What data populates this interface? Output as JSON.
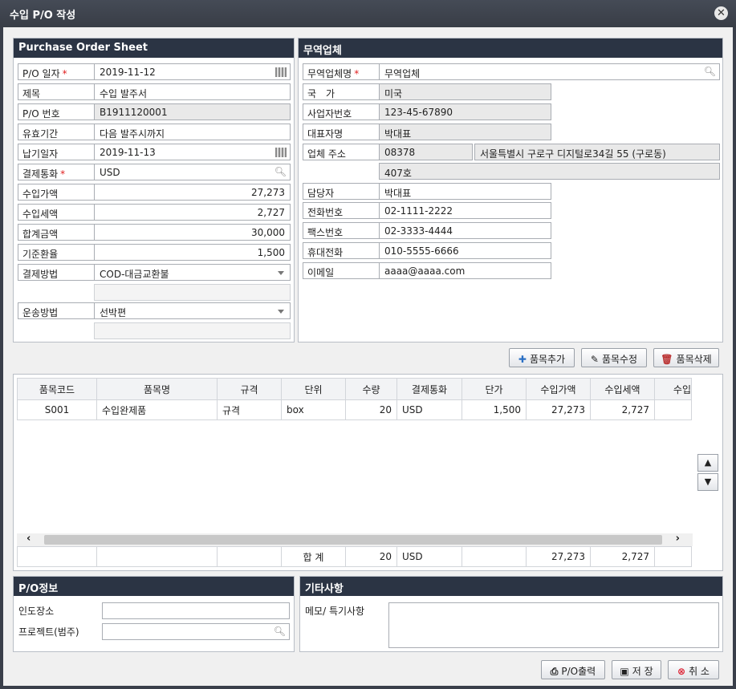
{
  "window": {
    "title": "수입 P/O 작성"
  },
  "po_sheet": {
    "header": "Purchase Order Sheet",
    "rows": [
      {
        "label": "P/O 일자",
        "required": "*",
        "value": "2019-11-12"
      },
      {
        "label": "제목",
        "value": "수입 발주서"
      },
      {
        "label": "P/O 번호",
        "value": "B1911120001"
      },
      {
        "label": "유효기간",
        "value": "다음 발주시까지"
      },
      {
        "label": "납기일자",
        "value": "2019-11-13"
      },
      {
        "label": "결제통화",
        "required": "*",
        "value": "USD"
      },
      {
        "label": "수입가액",
        "value": "27,273"
      },
      {
        "label": "수입세액",
        "value": "2,727"
      },
      {
        "label": "합계금액",
        "value": "30,000"
      },
      {
        "label": "기준환율",
        "value": "1,500"
      },
      {
        "label": "결제방법",
        "value": "COD-대금교환불"
      },
      {
        "label": "운송방법",
        "value": "선박편"
      }
    ]
  },
  "vendor": {
    "header": "무역업체",
    "rows": [
      {
        "label": "무역업체명",
        "required": "*",
        "value": "무역업체"
      },
      {
        "label": "국　가",
        "value": "미국"
      },
      {
        "label": "사업자번호",
        "value": "123-45-67890"
      },
      {
        "label": "대표자명",
        "value": "박대표"
      },
      {
        "label": "업체 주소",
        "value": "08378",
        "value2": "서울특별시 구로구 디지털로34길 55 (구로동)",
        "value3": "407호"
      },
      {
        "label": "담당자",
        "value": "박대표"
      },
      {
        "label": "전화번호",
        "value": "02-1111-2222"
      },
      {
        "label": "팩스번호",
        "value": "02-3333-4444"
      },
      {
        "label": "휴대전화",
        "value": "010-5555-6666"
      },
      {
        "label": "이메일",
        "value": "aaaa@aaaa.com"
      }
    ]
  },
  "item_buttons": {
    "add": "품목추가",
    "edit": "품목수정",
    "delete": "품목삭제"
  },
  "grid": {
    "columns": [
      "품목코드",
      "품목명",
      "규격",
      "단위",
      "수량",
      "결제통화",
      "단가",
      "수입가액",
      "수입세액",
      "수입"
    ],
    "rows": [
      [
        "S001",
        "수입완제품",
        "규격",
        "box",
        "20",
        "USD",
        "1,500",
        "27,273",
        "2,727",
        ""
      ]
    ],
    "totals": {
      "label": "합 계",
      "qty": "20",
      "currency": "USD",
      "amount": "27,273",
      "tax": "2,727"
    }
  },
  "po_info": {
    "header": "P/O정보",
    "place_label": "인도장소",
    "project_label": "프로젝트(범주)"
  },
  "etc": {
    "header": "기타사항",
    "memo_label": "메모/ 특기사항"
  },
  "footer": {
    "print": "P/O출력",
    "save": "저 장",
    "cancel": "취 소"
  },
  "icons": {
    "close": "close-icon",
    "search": "search-icon",
    "calendar": "calendar-icon"
  }
}
